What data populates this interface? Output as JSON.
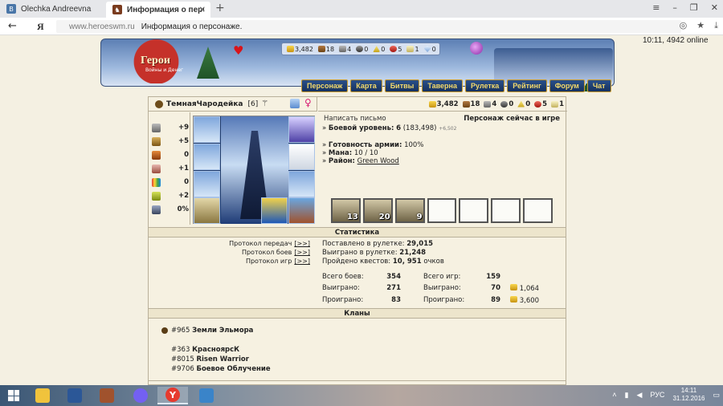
{
  "browser": {
    "tabs": [
      {
        "title": "Olechka Andreevna",
        "icon": "vk-icon",
        "color": "#4a76a8"
      },
      {
        "title": "Информация о персонаж",
        "icon": "heroes-icon",
        "color": "#7a3b1e"
      }
    ],
    "new_tab_symbol": "+",
    "window_controls": [
      "≡",
      "–",
      "❐",
      "✕"
    ],
    "back_symbol": "←",
    "yandex_symbol": "Я",
    "url_domain": "www.heroeswm.ru",
    "url_title": "Информация о персонаже."
  },
  "header": {
    "logo_text": "Герои",
    "logo_sub": "Войны и Денег",
    "server_status": "10:11, 4942 online",
    "resources": [
      {
        "icon": "gold-icon",
        "value": "3,482"
      },
      {
        "icon": "wood-icon",
        "value": "18"
      },
      {
        "icon": "ore-icon",
        "value": "4"
      },
      {
        "icon": "mercury-icon",
        "value": "0"
      },
      {
        "icon": "sulfur-icon",
        "value": "0"
      },
      {
        "icon": "crystal-icon",
        "value": "5"
      },
      {
        "icon": "gem-icon",
        "value": "1"
      },
      {
        "icon": "diamond-icon",
        "value": "0"
      }
    ],
    "menu": [
      "Персонаж",
      "Карта",
      "Битвы",
      "Таверна",
      "Рулетка",
      "Рейтинг",
      "Форум",
      "Чат"
    ]
  },
  "character": {
    "name": "ТемнаяЧародейка",
    "level": "[6]",
    "faction_symbol": "⚚",
    "gender_symbol": "♀",
    "resources": [
      {
        "icon": "gold-icon",
        "value": "3,482"
      },
      {
        "icon": "wood-icon",
        "value": "18"
      },
      {
        "icon": "ore-icon",
        "value": "4"
      },
      {
        "icon": "mercury-icon",
        "value": "0"
      },
      {
        "icon": "sulfur-icon",
        "value": "0"
      },
      {
        "icon": "crystal-icon",
        "value": "5"
      },
      {
        "icon": "gem-icon",
        "value": "1"
      }
    ],
    "stats": [
      {
        "icon": "attack-icon",
        "value": "+9"
      },
      {
        "icon": "defense-icon",
        "value": "+5"
      },
      {
        "icon": "spellpower-icon",
        "value": "0"
      },
      {
        "icon": "knowledge-icon",
        "value": "+1"
      },
      {
        "icon": "luck-icon",
        "value": "0"
      },
      {
        "icon": "morale-icon",
        "value": "+2"
      },
      {
        "icon": "initiative-icon",
        "value": "0%"
      }
    ],
    "write_letter": "Написать письмо",
    "ingame_status": "Персонаж сейчас в игре",
    "combat_level_label": "Боевой уровень:",
    "combat_level_value": "6",
    "combat_level_exp": "(183,498)",
    "combat_level_extra": "+6,502",
    "army_ready_label": "Готовность армии:",
    "army_ready_value": "100%",
    "mana_label": "Мана:",
    "mana_value": "10 / 10",
    "district_label": "Район:",
    "district_value": "Green Wood",
    "army": [
      {
        "count": "13",
        "filled": true
      },
      {
        "count": "20",
        "filled": true
      },
      {
        "count": "9",
        "filled": true
      },
      {
        "count": "",
        "filled": false
      },
      {
        "count": "",
        "filled": false
      },
      {
        "count": "",
        "filled": false
      },
      {
        "count": "",
        "filled": false
      }
    ]
  },
  "statistics": {
    "title": "Статистика",
    "protocols": [
      {
        "label": "Протокол передач",
        "link": "[>>]"
      },
      {
        "label": "Протокол боев",
        "link": "[>>]"
      },
      {
        "label": "Протокол игр",
        "link": "[>>]"
      }
    ],
    "roulette_bet_label": "Поставлено в рулетке:",
    "roulette_bet_value": "29,015",
    "roulette_won_label": "Выиграно в рулетке:",
    "roulette_won_value": "21,248",
    "quests_label": "Пройдено квестов:",
    "quests_value": "10, 951",
    "quests_unit": "очков",
    "battles_total_label": "Всего боев:",
    "battles_total": "354",
    "battles_won_label": "Выиграно:",
    "battles_won": "271",
    "battles_lost_label": "Проиграно:",
    "battles_lost": "83",
    "games_total_label": "Всего игр:",
    "games_total": "159",
    "games_won_label": "Выиграно:",
    "games_won": "70",
    "games_won_gold": "1,064",
    "games_lost_label": "Проиграно:",
    "games_lost": "89",
    "games_lost_gold": "3,600"
  },
  "clans": {
    "title": "Кланы",
    "main": {
      "id": "#965",
      "name": "Земли Эльмора"
    },
    "list": [
      {
        "id": "#363",
        "name": "КраснoярсК"
      },
      {
        "id": "#8015",
        "name": "Risen Warrior"
      },
      {
        "id": "#9706",
        "name": "Боевое Облучение"
      }
    ]
  },
  "taskbar": {
    "apps": [
      {
        "icon": "file-explorer-icon",
        "color": "#f0c33c"
      },
      {
        "icon": "word-icon",
        "color": "#2b5797"
      },
      {
        "icon": "photo-icon",
        "color": "#a0522d"
      },
      {
        "icon": "viber-icon",
        "color": "#7360f2"
      },
      {
        "icon": "yandex-browser-icon",
        "color": "#e63a2e",
        "glyph": "Y"
      },
      {
        "icon": "image-viewer-icon",
        "color": "#3a84c9"
      }
    ],
    "language": "РУС",
    "time": "14:11",
    "date": "31.12.2016"
  }
}
